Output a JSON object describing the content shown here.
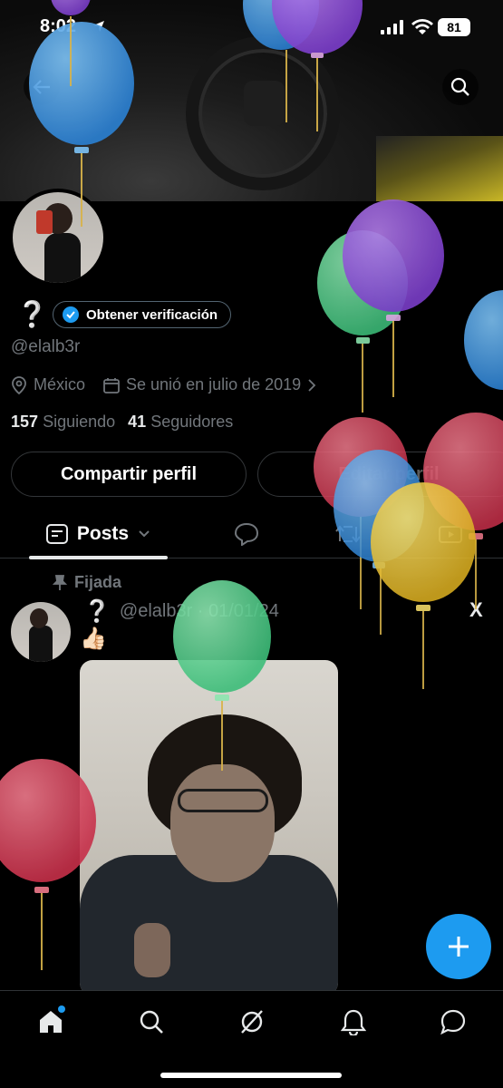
{
  "status_bar": {
    "time": "8:02",
    "battery": "81"
  },
  "profile": {
    "display_name": "❔",
    "verify_label": "Obtener verificación",
    "handle": "@elalb3r",
    "location": "México",
    "joined": "Se unió en julio de 2019",
    "following_count": "157",
    "following_label": "Siguiendo",
    "followers_count": "41",
    "followers_label": "Seguidores"
  },
  "actions": {
    "share_label": "Compartir perfil",
    "edit_label": "Editar perfil"
  },
  "tabs": {
    "posts_label": "Posts"
  },
  "post": {
    "pinned_label": "Fijada",
    "author_name": "❔",
    "author_handle": "@elalb3r · 01/01/24",
    "text": "👍🏻",
    "source_icon": "X"
  },
  "colors": {
    "accent": "#1d9bf0",
    "background": "#000000",
    "secondary_text": "#71767b"
  },
  "icons": [
    "back-arrow-icon",
    "search-icon",
    "location-icon",
    "calendar-icon",
    "posts-icon",
    "reply-icon",
    "repost-icon",
    "media-icon",
    "pin-icon",
    "compose-icon",
    "home-icon",
    "explore-icon",
    "grok-icon",
    "notifications-icon",
    "messages-icon"
  ]
}
